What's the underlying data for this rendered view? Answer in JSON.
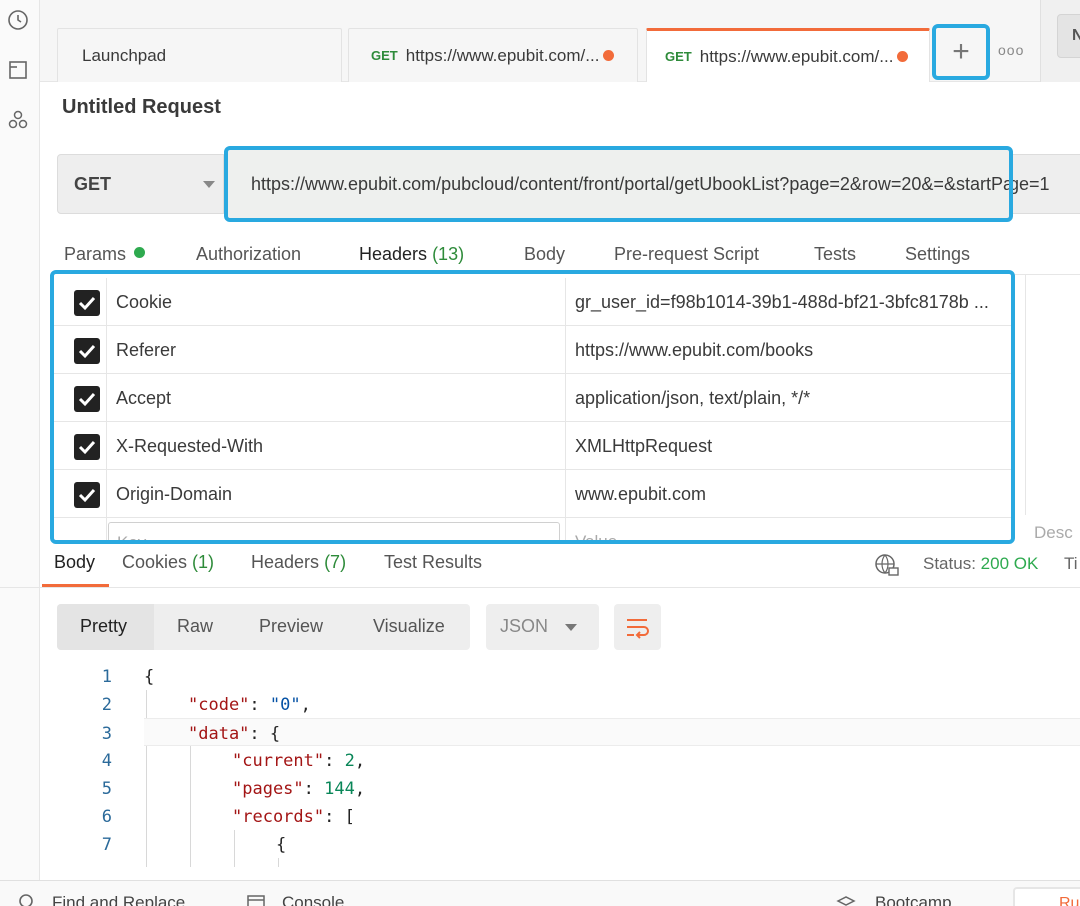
{
  "tabs": [
    {
      "label": "Launchpad",
      "method": "",
      "url": ""
    },
    {
      "label": "",
      "method": "GET",
      "url": "https://www.epubit.com/..."
    },
    {
      "label": "",
      "method": "GET",
      "url": "https://www.epubit.com/..."
    }
  ],
  "tabbar": {
    "plus": "+",
    "more": "ooo",
    "right_button": "N"
  },
  "request": {
    "title": "Untitled Request",
    "method": "GET",
    "url": "https://www.epubit.com/pubcloud/content/front/portal/getUbookList?page=2&row=20&=&startPage=1"
  },
  "request_tabs": [
    {
      "label": "Params",
      "count": ""
    },
    {
      "label": "Authorization",
      "count": ""
    },
    {
      "label": "Headers",
      "count": "(13)"
    },
    {
      "label": "Body",
      "count": ""
    },
    {
      "label": "Pre-request Script",
      "count": ""
    },
    {
      "label": "Tests",
      "count": ""
    },
    {
      "label": "Settings",
      "count": ""
    }
  ],
  "headers": [
    {
      "key": "Cookie",
      "value": "gr_user_id=f98b1014-39b1-488d-bf21-3bfc8178b ...",
      "checked": true
    },
    {
      "key": "Referer",
      "value": "https://www.epubit.com/books",
      "checked": true
    },
    {
      "key": "Accept",
      "value": "application/json, text/plain, */*",
      "checked": true
    },
    {
      "key": "X-Requested-With",
      "value": "XMLHttpRequest",
      "checked": true
    },
    {
      "key": "Origin-Domain",
      "value": "www.epubit.com",
      "checked": true
    }
  ],
  "new_header": {
    "key_placeholder": "Key",
    "value_placeholder": "Value",
    "desc_placeholder": "Desc"
  },
  "response_tabs": [
    {
      "label": "Body",
      "count": ""
    },
    {
      "label": "Cookies",
      "count": "(1)"
    },
    {
      "label": "Headers",
      "count": "(7)"
    },
    {
      "label": "Test Results",
      "count": ""
    }
  ],
  "status": {
    "label": "Status:",
    "value": "200 OK",
    "time_stub": "Ti"
  },
  "view_modes": [
    "Pretty",
    "Raw",
    "Preview",
    "Visualize"
  ],
  "format": "JSON",
  "code_lines": [
    {
      "n": "1",
      "text": "{"
    },
    {
      "n": "2",
      "text": "\"code\": \"0\","
    },
    {
      "n": "3",
      "text": "\"data\": {"
    },
    {
      "n": "4",
      "text": "\"current\": 2,"
    },
    {
      "n": "5",
      "text": "\"pages\": 144,"
    },
    {
      "n": "6",
      "text": "\"records\": ["
    },
    {
      "n": "7",
      "text": "{"
    }
  ],
  "footer": {
    "find_replace": "Find and Replace",
    "console": "Console",
    "bootcamp": "Bootcamp",
    "button": "Ru"
  },
  "colors": {
    "accent": "#f26b3a",
    "highlight": "#29a9e0",
    "success": "#2eaa4f"
  }
}
